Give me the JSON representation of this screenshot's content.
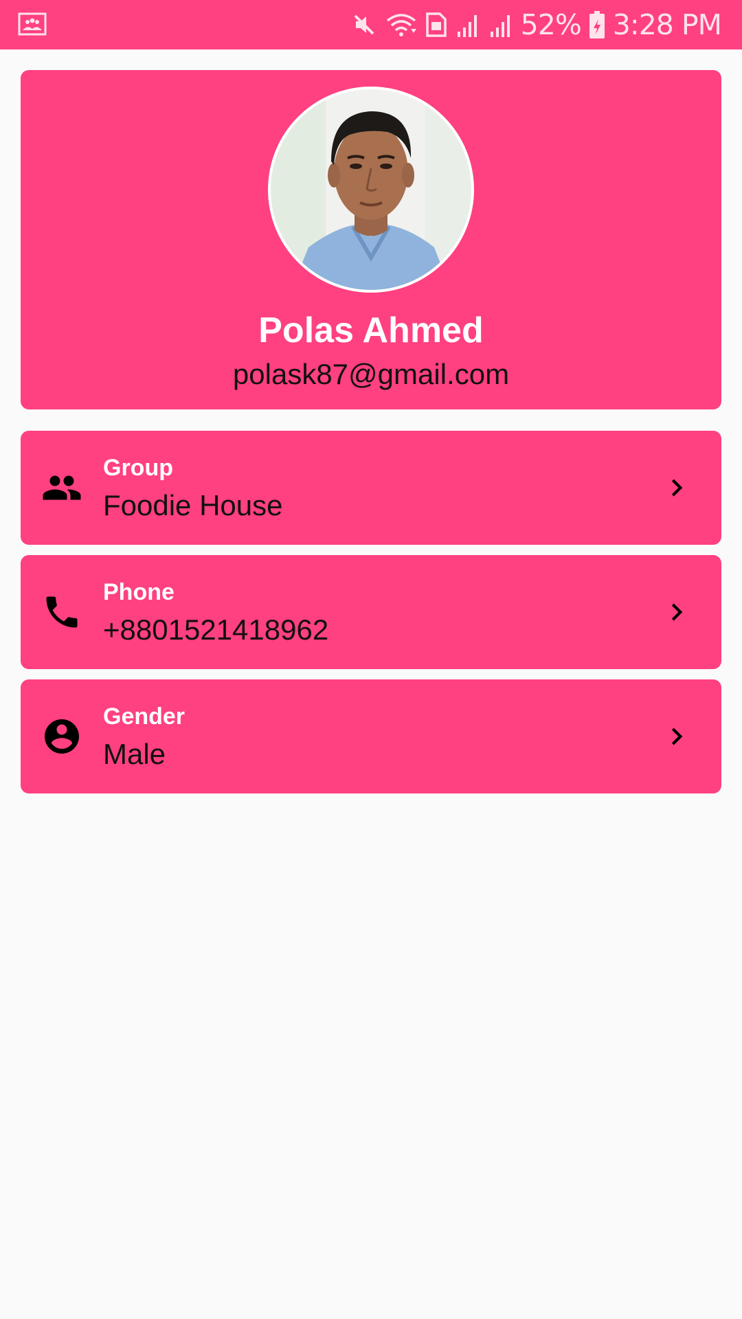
{
  "status_bar": {
    "left_icon": "gallery-notification-icon",
    "icons": [
      "mute-icon",
      "wifi-icon",
      "hd-sim-icon",
      "signal-icon",
      "signal-icon",
      "battery-charging-icon"
    ],
    "battery": "52%",
    "time": "3:28 PM"
  },
  "profile": {
    "avatar": "profile-photo",
    "name": "Polas Ahmed",
    "email": "polask87@gmail.com"
  },
  "info_items": [
    {
      "icon": "group-icon",
      "label": "Group",
      "value": "Foodie House"
    },
    {
      "icon": "phone-icon",
      "label": "Phone",
      "value": "+8801521418962"
    },
    {
      "icon": "account-circle-icon",
      "label": "Gender",
      "value": "Male"
    }
  ],
  "colors": {
    "accent": "#ff4081",
    "background": "#fafafa",
    "label_text": "#ffffff",
    "value_text": "#111111"
  }
}
